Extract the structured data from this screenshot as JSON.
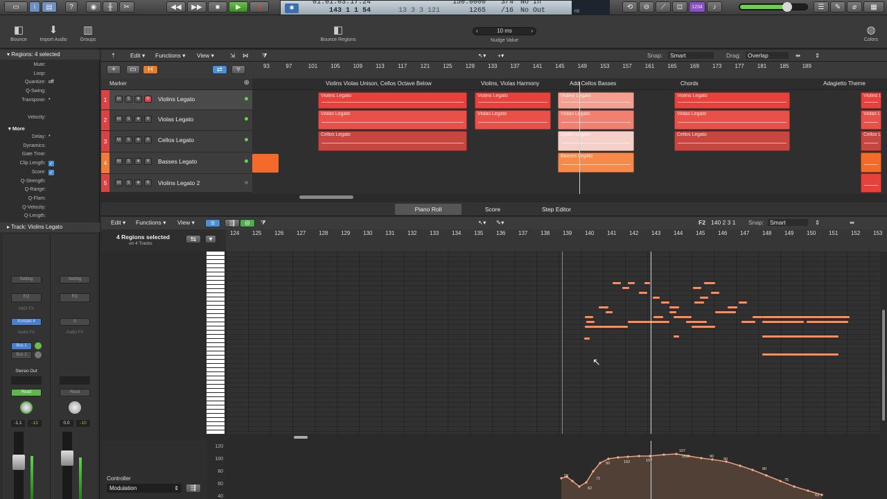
{
  "control_bar": {
    "lcd_time": "01:01:03:17.24",
    "lcd_position": "143  1  1    54",
    "lcd_position2": "13  3  3  121",
    "lcd_tempo": "150.0000",
    "lcd_tempo2": "1265",
    "lcd_sig": "3/4",
    "lcd_div": "/16",
    "lcd_in": "No In",
    "lcd_out": "No Out",
    "lcd_hd": "HD",
    "mode_badge": "1234"
  },
  "toolbar": {
    "bounce": "Bounce",
    "import_audio": "Import Audio",
    "groups": "Groups",
    "bounce_regions": "Bounce Regions",
    "nudge_value": "10 ms",
    "nudge_label": "Nudge Value",
    "colors": "Colors"
  },
  "inspector": {
    "header": "Regions: 4 selected",
    "rows": [
      {
        "k": "Mute:",
        "v": ""
      },
      {
        "k": "Loop:",
        "v": ""
      },
      {
        "k": "Quantize:",
        "v": "off"
      },
      {
        "k": "Q-Swing:",
        "v": ""
      },
      {
        "k": "Transpose:",
        "v": "*"
      },
      {
        "k": "",
        "v": ""
      },
      {
        "k": "Velocity:",
        "v": ""
      }
    ],
    "more": "More",
    "more_rows": [
      {
        "k": "Delay:",
        "v": "*"
      },
      {
        "k": "Dynamics:",
        "v": ""
      },
      {
        "k": "Gate Time:",
        "v": ""
      },
      {
        "k": "Clip Length:",
        "v": "✓"
      },
      {
        "k": "Score:",
        "v": "✓"
      },
      {
        "k": "Q-Strength:",
        "v": ""
      },
      {
        "k": "Q-Range:",
        "v": ""
      },
      {
        "k": "Q-Flam:",
        "v": ""
      },
      {
        "k": "Q-Velocity:",
        "v": ""
      },
      {
        "k": "Q-Length:",
        "v": ""
      }
    ],
    "track_label": "Track: Violins Legato",
    "strip": {
      "setting": "Setting",
      "eq": "EQ",
      "midi_fx": "MIDI FX",
      "instrument": "Kontakt 4",
      "audio_fx": "Audio FX",
      "bus1": "Bus 1",
      "bus2": "Bus 2",
      "output": "Stereo Out",
      "read": "Read",
      "vol_left": "-1.1",
      "peak_left": "-13",
      "vol_right": "0.0",
      "peak_right": "-10"
    }
  },
  "tracks_header": {
    "edit": "Edit",
    "functions": "Functions",
    "view": "View",
    "snap_label": "Snap:",
    "snap_value": "Smart",
    "drag_label": "Drag:",
    "drag_value": "Overlap",
    "marker_label": "Marker"
  },
  "ruler_top": [
    "93",
    "97",
    "101",
    "105",
    "109",
    "113",
    "117",
    "121",
    "125",
    "129",
    "133",
    "137",
    "141",
    "145",
    "149",
    "153",
    "157",
    "161",
    "165",
    "169",
    "173",
    "177",
    "181",
    "185",
    "189"
  ],
  "markers": [
    "Violins Violas Unison, Cellos Octave Below",
    "Violins, Violas Harmony",
    "Add Cellos Basses",
    "Chords",
    "Adagietto Theme"
  ],
  "tracks": [
    {
      "num": "1",
      "name": "Violins Legato"
    },
    {
      "num": "2",
      "name": "Violas Legato"
    },
    {
      "num": "3",
      "name": "Cellos Legato"
    },
    {
      "num": "4",
      "name": "Basses Legato"
    },
    {
      "num": "5",
      "name": "Violins Legato 2"
    }
  ],
  "region_names": {
    "violins": "Violins Legato",
    "violas": "Violas Legato",
    "cellos": "Cellos Legato",
    "basses": "Basses Legato"
  },
  "editor_tabs": [
    "Piano Roll",
    "Score",
    "Step Editor"
  ],
  "piano_roll": {
    "edit": "Edit",
    "functions": "Functions",
    "view": "View",
    "selection": "4 Regions selected",
    "selection_sub": "on 4 Tracks",
    "position_note": "F2",
    "position_value": "140 2 3 1",
    "snap_label": "Snap:",
    "snap_value": "Smart",
    "ruler": [
      "124",
      "125",
      "126",
      "127",
      "128",
      "129",
      "130",
      "131",
      "132",
      "133",
      "134",
      "135",
      "136",
      "137",
      "138",
      "139",
      "140",
      "141",
      "142",
      "143",
      "144",
      "145",
      "146",
      "147",
      "148",
      "149",
      "150",
      "151",
      "152",
      "153"
    ],
    "controller_label": "Controller",
    "controller_value": "Modulation",
    "cc_ticks": [
      "120",
      "100",
      "80",
      "60",
      "40"
    ],
    "velocity_labels": [
      "58",
      "62",
      "72",
      "90",
      "102",
      "107",
      "107",
      "102",
      "90",
      "90",
      "80",
      "75",
      "63"
    ]
  },
  "colors": {
    "region_red": "#e8403a",
    "region_salmon": "#f07060",
    "region_orange": "#f46a2a",
    "note": "#ff8a5a",
    "playhead": "#cfd6dc",
    "accent_blue": "#4a8fd8"
  }
}
